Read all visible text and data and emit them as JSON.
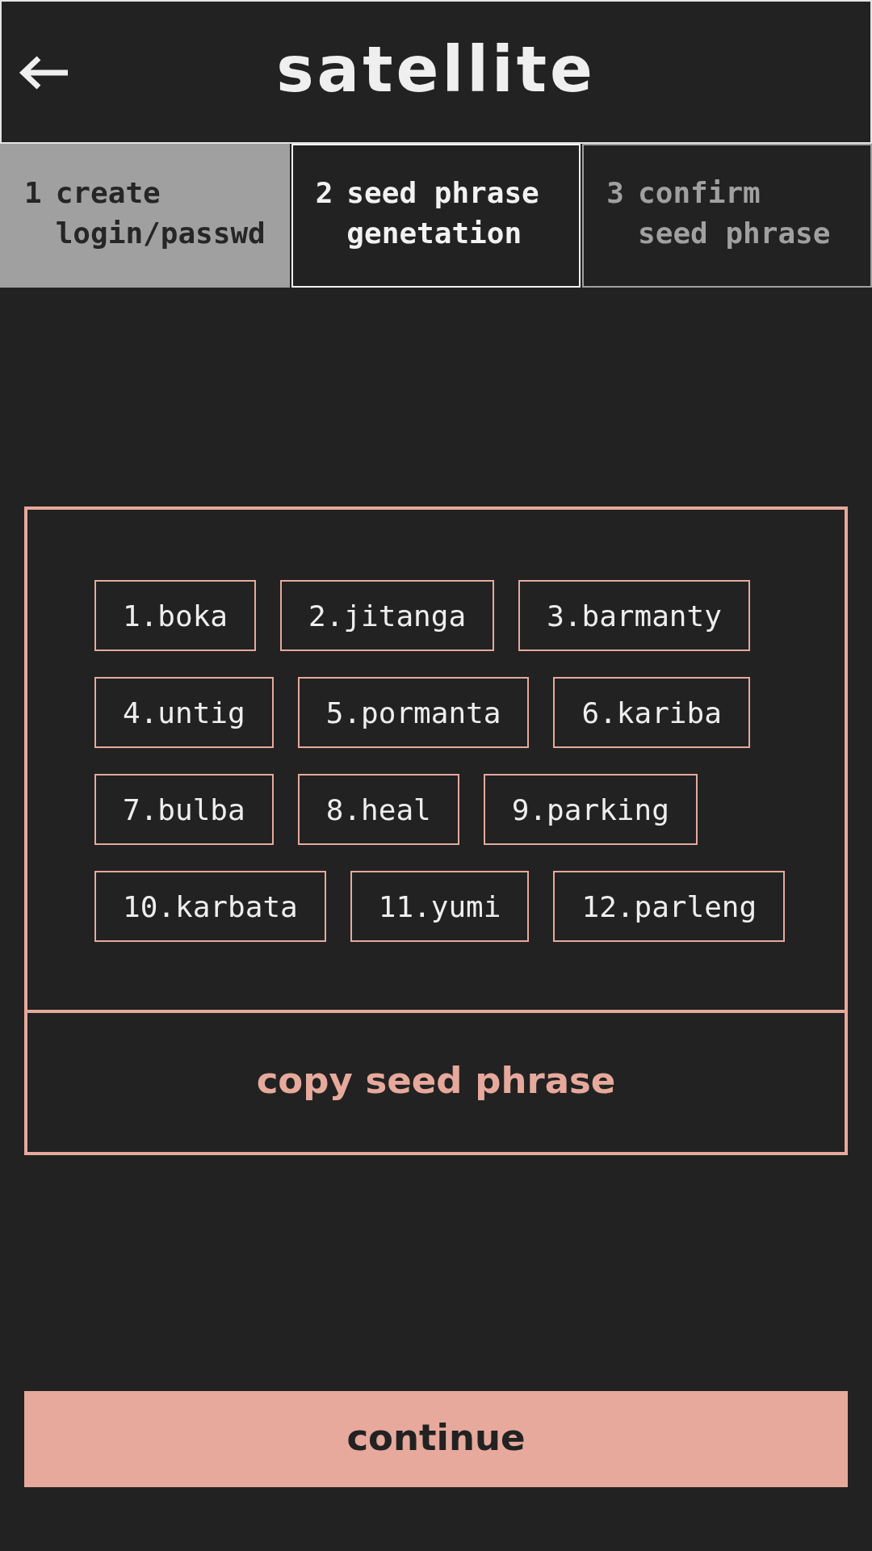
{
  "header": {
    "title": "satellite"
  },
  "steps": [
    {
      "number": "1",
      "label_lines": [
        "create",
        "login/passwd"
      ],
      "completed": true,
      "selected": false
    },
    {
      "number": "2",
      "label_lines": [
        "seed phrase",
        "genetation"
      ],
      "completed": false,
      "selected": true
    },
    {
      "number": "3",
      "label_lines": [
        "confirm",
        "seed phrase"
      ],
      "completed": false,
      "selected": false
    }
  ],
  "seed_phrase": {
    "words": [
      "1.boka",
      "2.jitanga",
      "3.barmanty",
      "4.untig",
      "5.pormanta",
      "6.kariba",
      "7.bulba",
      "8.heal",
      "9.parking",
      "10.karbata",
      "11.yumi",
      "12.parleng"
    ],
    "copy_button": "copy seed phrase"
  },
  "continue_button": "continue"
}
